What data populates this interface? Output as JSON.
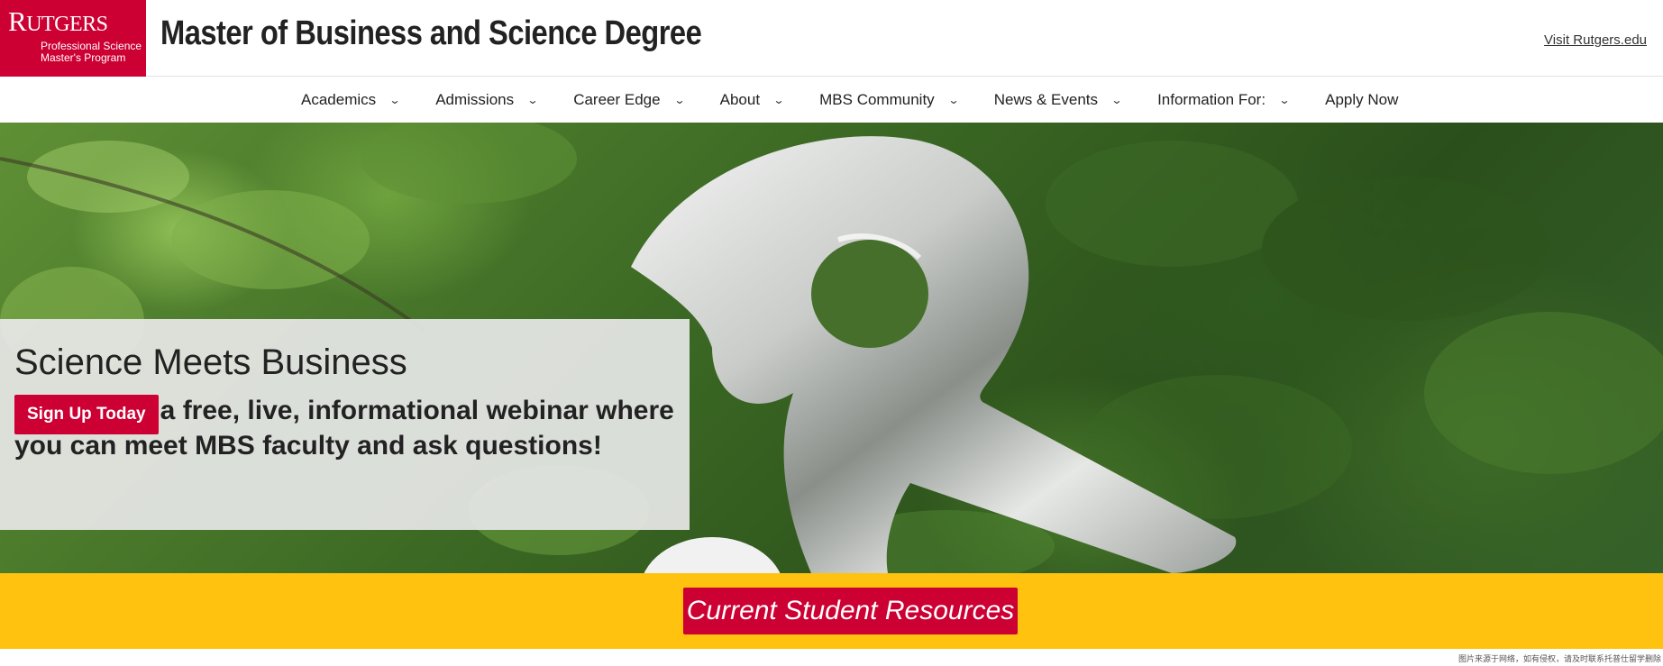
{
  "header": {
    "logo_word_big": "R",
    "logo_word_rest": "UTGERS",
    "logo_sub_line1": "Professional Science",
    "logo_sub_line2": "Master's Program",
    "site_title": "Master of Business and Science Degree",
    "visit_link": "Visit Rutgers.edu"
  },
  "nav": {
    "items": [
      {
        "label": "Academics",
        "icon": "chevron-down-icon"
      },
      {
        "label": "Admissions",
        "icon": "chevron-down-icon"
      },
      {
        "label": "Career Edge",
        "icon": "chevron-down-icon"
      },
      {
        "label": "About",
        "icon": "chevron-down-icon"
      },
      {
        "label": "MBS Community",
        "icon": "chevron-down-icon"
      },
      {
        "label": "News & Events",
        "icon": "chevron-down-icon"
      },
      {
        "label": "Information For:",
        "icon": "chevron-down-icon"
      },
      {
        "label": "Apply Now"
      }
    ],
    "chevron_glyph": "⌄"
  },
  "hero": {
    "title": "Science Meets Business",
    "text": "Join us for a free, live, informational webinar where you can meet MBS faculty and ask questions!",
    "button": "Sign Up Today"
  },
  "band": {
    "button": "Current Student Resources"
  },
  "colors": {
    "brand_red": "#cc0033",
    "band_yellow": "#ffc20e"
  },
  "footnote": "图片来源于网络，如有侵权，请及时联系托普仕留学删除"
}
